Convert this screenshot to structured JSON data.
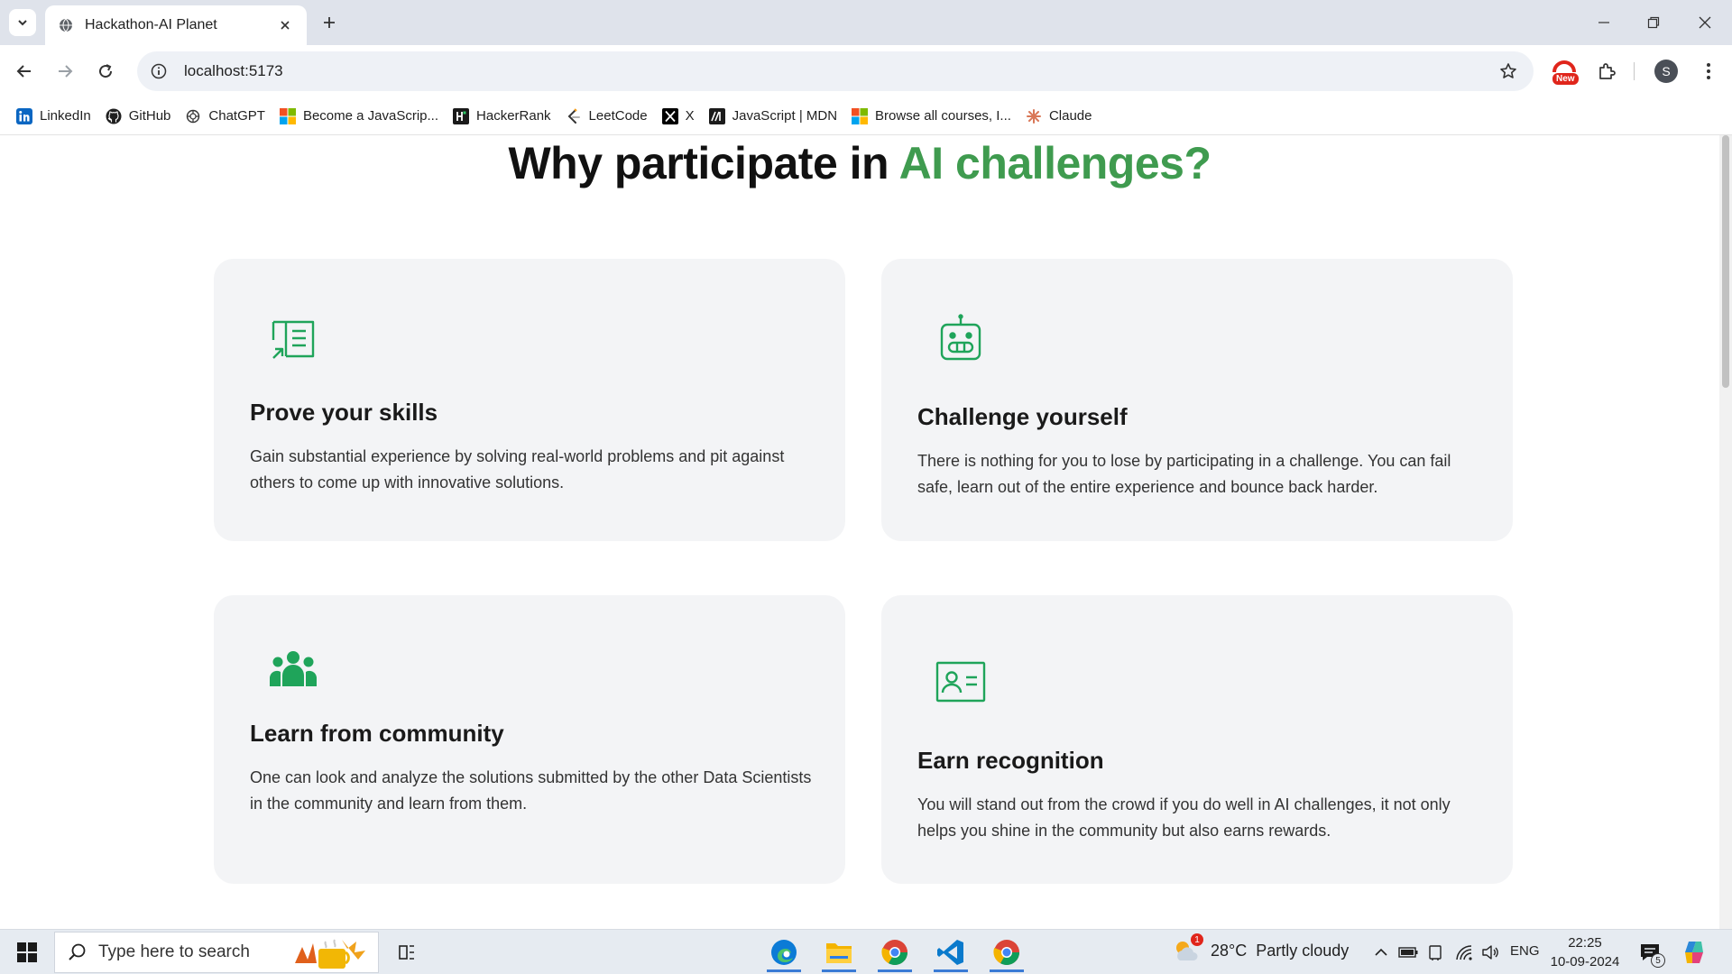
{
  "browser": {
    "tab": {
      "title": "Hackathon-AI Planet"
    },
    "address_bar": {
      "url": "localhost:5173"
    },
    "extension_badge": "New",
    "profile_initial": "S",
    "bookmarks": [
      {
        "label": "LinkedIn",
        "icon": "linkedin-icon"
      },
      {
        "label": "GitHub",
        "icon": "github-icon"
      },
      {
        "label": "ChatGPT",
        "icon": "chatgpt-icon"
      },
      {
        "label": "Become a JavaScrip...",
        "icon": "microsoft-icon"
      },
      {
        "label": "HackerRank",
        "icon": "hackerrank-icon"
      },
      {
        "label": "LeetCode",
        "icon": "leetcode-icon"
      },
      {
        "label": "X",
        "icon": "x-icon"
      },
      {
        "label": "JavaScript | MDN",
        "icon": "mdn-icon"
      },
      {
        "label": "Browse all courses, I...",
        "icon": "microsoft-icon"
      },
      {
        "label": "Claude",
        "icon": "claude-icon"
      }
    ]
  },
  "section": {
    "title_plain": "Why participate in ",
    "title_accent": "AI challenges?",
    "accent_color": "#3f9b4f",
    "cards": [
      {
        "icon": "checklist-icon",
        "title": "Prove your skills",
        "body": "Gain substantial experience by solving real-world problems and pit against others to come up with innovative solutions."
      },
      {
        "icon": "robot-icon",
        "title": "Challenge yourself",
        "body": "There is nothing for you to lose by participating in a challenge. You can fail safe, learn out of the entire experience and bounce back harder."
      },
      {
        "icon": "community-icon",
        "title": "Learn from community",
        "body": "One can look and analyze the solutions submitted by the other Data Scientists in the community and learn from them."
      },
      {
        "icon": "id-card-icon",
        "title": "Earn recognition",
        "body": "You will stand out from the crowd if you do well in AI challenges, it not only helps you shine in the community but also earns rewards."
      }
    ]
  },
  "taskbar": {
    "search_placeholder": "Type here to search",
    "weather": {
      "temp": "28°C",
      "condition": "Partly cloudy",
      "alert_count": "1"
    },
    "language": "ENG",
    "time": "22:25",
    "date": "10-09-2024",
    "notification_count": "5"
  }
}
